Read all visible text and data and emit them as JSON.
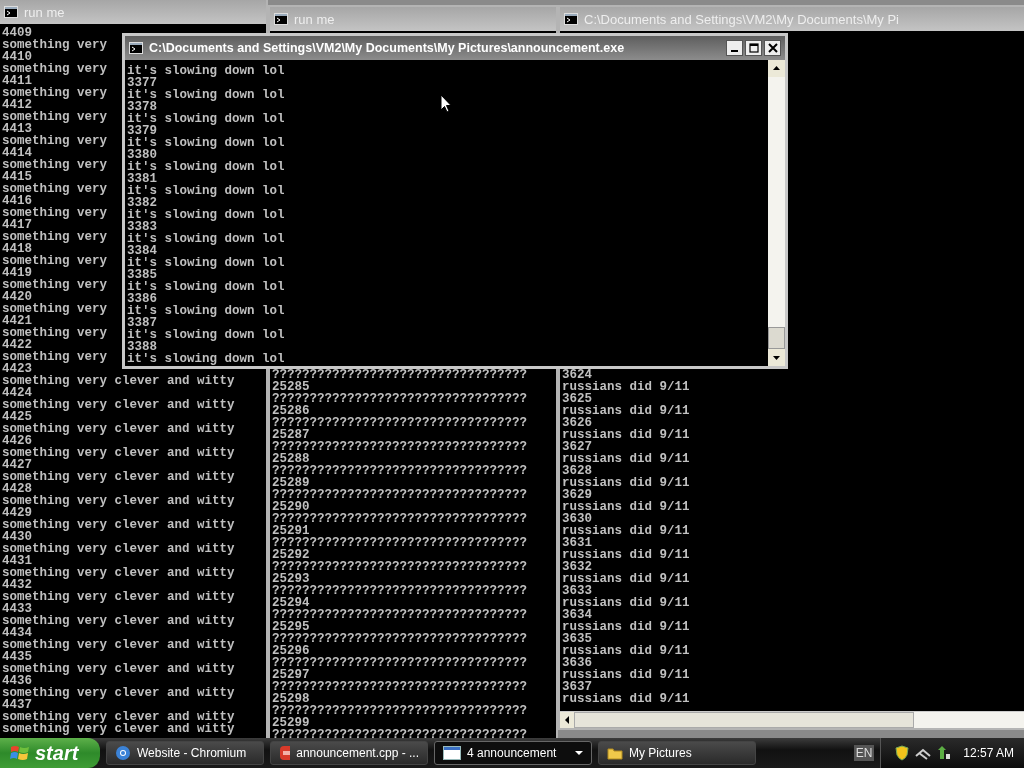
{
  "windows": [
    {
      "title": "run me",
      "active": false,
      "lines": [
        "4409",
        "something very",
        "4410",
        "something very",
        "4411",
        "something very",
        "4412",
        "something very",
        "4413",
        "something very",
        "4414",
        "something very",
        "4415",
        "something very",
        "4416",
        "something very",
        "4417",
        "something very",
        "4418",
        "something very",
        "4419",
        "something very",
        "4420",
        "something very",
        "4421",
        "something very",
        "4422",
        "something very",
        "4423",
        "something very clever and witty",
        "4424",
        "something very clever and witty",
        "4425",
        "something very clever and witty",
        "4426",
        "something very clever and witty",
        "4427",
        "something very clever and witty",
        "4428",
        "something very clever and witty",
        "4429",
        "something very clever and witty",
        "4430",
        "something very clever and witty",
        "4431",
        "something very clever and witty",
        "4432",
        "something very clever and witty",
        "4433",
        "something very clever and witty",
        "4434",
        "something very clever and witty",
        "4435",
        "something very clever and witty",
        "4436",
        "something very clever and witty",
        "4437",
        "something very clever and witty",
        "something very clever and witty"
      ]
    },
    {
      "title": "run me",
      "active": false,
      "lines": [
        "??????????????????????????????????",
        "25285",
        "??????????????????????????????????",
        "25286",
        "??????????????????????????????????",
        "25287",
        "??????????????????????????????????",
        "25288",
        "??????????????????????????????????",
        "25289",
        "??????????????????????????????????",
        "25290",
        "??????????????????????????????????",
        "25291",
        "??????????????????????????????????",
        "25292",
        "??????????????????????????????????",
        "25293",
        "??????????????????????????????????",
        "25294",
        "??????????????????????????????????",
        "25295",
        "??????????????????????????????????",
        "25296",
        "??????????????????????????????????",
        "25297",
        "??????????????????????????????????",
        "25298",
        "??????????????????????????????????",
        "25299",
        "??????????????????????????????????"
      ]
    },
    {
      "title": "C:\\Documents and Settings\\VM2\\My Documents\\My Pi",
      "active": false,
      "lines": [
        "3624",
        "russians did 9/11",
        "3625",
        "russians did 9/11",
        "3626",
        "russians did 9/11",
        "3627",
        "russians did 9/11",
        "3628",
        "russians did 9/11",
        "3629",
        "russians did 9/11",
        "3630",
        "russians did 9/11",
        "3631",
        "russians did 9/11",
        "3632",
        "russians did 9/11",
        "3633",
        "russians did 9/11",
        "3634",
        "russians did 9/11",
        "3635",
        "russians did 9/11",
        "3636",
        "russians did 9/11",
        "3637",
        "russians did 9/11"
      ]
    },
    {
      "title": "C:\\Documents and Settings\\VM2\\My Documents\\My Pictures\\announcement.exe",
      "active": true,
      "lines": [
        "it's slowing down lol",
        "3377",
        "it's slowing down lol",
        "3378",
        "it's slowing down lol",
        "3379",
        "it's slowing down lol",
        "3380",
        "it's slowing down lol",
        "3381",
        "it's slowing down lol",
        "3382",
        "it's slowing down lol",
        "3383",
        "it's slowing down lol",
        "3384",
        "it's slowing down lol",
        "3385",
        "it's slowing down lol",
        "3386",
        "it's slowing down lol",
        "3387",
        "it's slowing down lol",
        "3388",
        "it's slowing down lol"
      ]
    }
  ],
  "taskbar": {
    "start": "start",
    "items": [
      {
        "label": "Website - Chromium",
        "kind": "browser",
        "selected": false
      },
      {
        "label": "announcement.cpp - ...",
        "kind": "editor",
        "selected": false
      },
      {
        "label": "4 announcement",
        "kind": "console",
        "selected": true
      },
      {
        "label": "My Pictures",
        "kind": "folder",
        "selected": false
      }
    ],
    "language": "EN",
    "clock": "12:57 AM"
  }
}
